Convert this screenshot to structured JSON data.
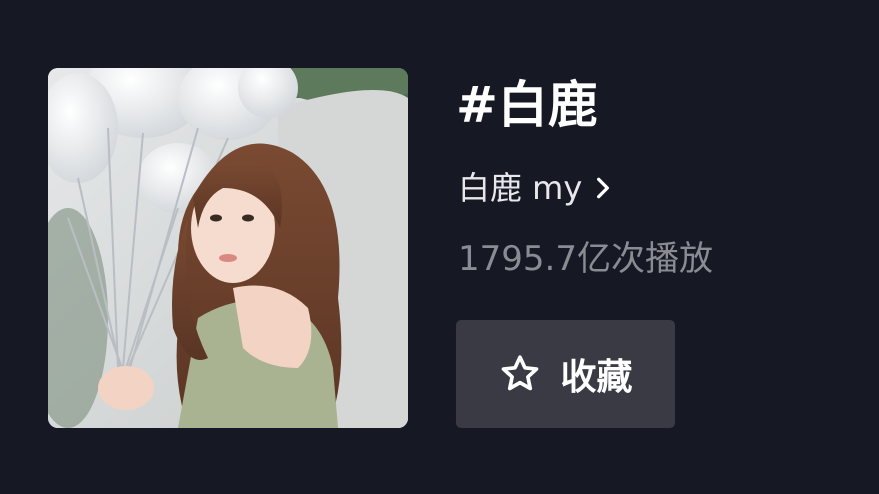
{
  "topic": {
    "title": "#白鹿",
    "author": "白鹿 my",
    "play_count": "1795.7亿次播放"
  },
  "actions": {
    "favorite_label": "收藏"
  },
  "icons": {
    "author_link": "chevron-right-icon",
    "favorite": "star-outline-icon"
  },
  "colors": {
    "background": "#161823",
    "button": "#393a44",
    "title": "#ffffff",
    "secondary_text": "#8a8b93"
  },
  "watermark": ""
}
